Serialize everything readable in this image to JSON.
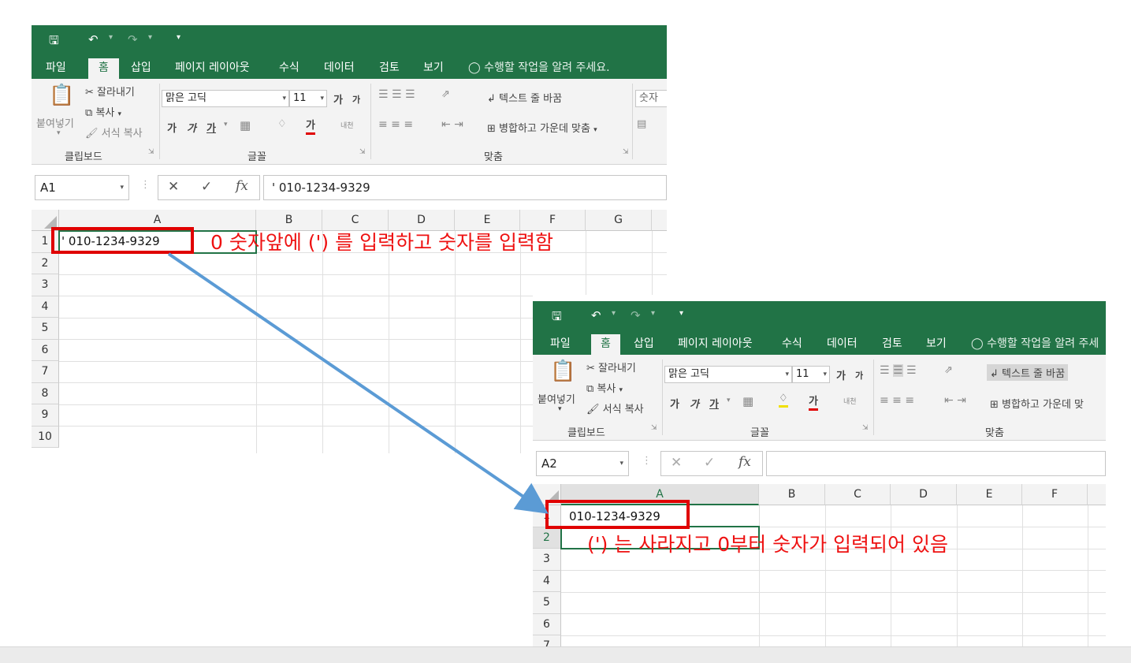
{
  "colors": {
    "excel_green": "#217346",
    "annotation_red": "#ee1111",
    "arrow_blue": "#5b9bd5"
  },
  "ribbon": {
    "tabs": [
      "파일",
      "홈",
      "삽입",
      "페이지 레이아웃",
      "수식",
      "데이터",
      "검토",
      "보기"
    ],
    "active_tab": "홈",
    "tell_me": "수행할 작업을 알려 주세요.",
    "tell_me_cut": "수행할 작업을 알려 주세",
    "clipboard": {
      "paste": "붙여넣기",
      "cut": "잘라내기",
      "copy": "복사",
      "format_painter": "서식 복사",
      "group": "클립보드"
    },
    "font": {
      "name": "맑은 고딕",
      "size": "11",
      "grow": "가",
      "shrink": "가",
      "bold": "가",
      "italic": "가",
      "underline": "가",
      "font_color": "가",
      "phonetic": "내천",
      "group": "글꼴"
    },
    "alignment": {
      "wrap": "텍스트 줄 바꿈",
      "merge": "병합하고 가운데 맞춤",
      "merge_cut": "병합하고 가운데 맞",
      "group": "맞춤"
    },
    "number": {
      "format": "숫자"
    }
  },
  "before": {
    "name_box": "A1",
    "formula": "' 010-1234-9329",
    "columns": [
      "A",
      "B",
      "C",
      "D",
      "E",
      "F",
      "G"
    ],
    "rows": [
      "1",
      "2",
      "3",
      "4",
      "5",
      "6",
      "7",
      "8",
      "9",
      "10"
    ],
    "cell_a1": "' 010-1234-9329"
  },
  "after": {
    "name_box": "A2",
    "formula": "",
    "columns": [
      "A",
      "B",
      "C",
      "D",
      "E",
      "F"
    ],
    "rows": [
      "1",
      "2",
      "3",
      "4",
      "5",
      "6",
      "7"
    ],
    "cell_a1": "010-1234-9329"
  },
  "annotations": {
    "top": "0  숫자앞에 (') 를 입력하고 숫자를 입력함",
    "bottom": "(') 는 사라지고 0부터 숫자가 입력되어 있음"
  }
}
